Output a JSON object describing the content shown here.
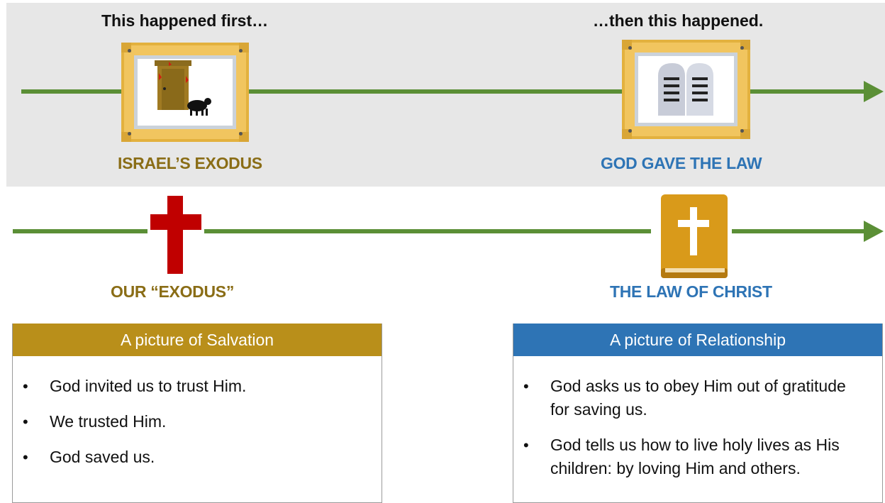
{
  "top": {
    "left_heading": "This happened first…",
    "right_heading": "…then this happened.",
    "left_label": "ISRAEL’S EXODUS",
    "right_label": "GOD GAVE THE LAW",
    "left_icon": "passover-door-lamb-icon",
    "right_icon": "tablets-of-law-icon"
  },
  "bottom": {
    "left_label": "OUR “EXODUS”",
    "right_label": "THE LAW OF CHRIST",
    "left_icon": "cross-icon",
    "right_icon": "bible-icon"
  },
  "cards": [
    {
      "title": "A picture of Salvation",
      "color": "#b98f1a",
      "bullets": [
        "God invited us to trust Him.",
        "We trusted Him.",
        "God saved us."
      ]
    },
    {
      "title": "A picture of Relationship",
      "color": "#2e74b5",
      "bullets": [
        "God asks us to obey Him out of gratitude for saving us.",
        "God tells us how to live holy lives as His children: by loving Him and others."
      ]
    }
  ],
  "colors": {
    "timeline": "#5b8f36",
    "gold_label": "#8a6d16",
    "blue_label": "#2e74b5",
    "cross": "#c00000",
    "bible": "#d99a1a"
  }
}
